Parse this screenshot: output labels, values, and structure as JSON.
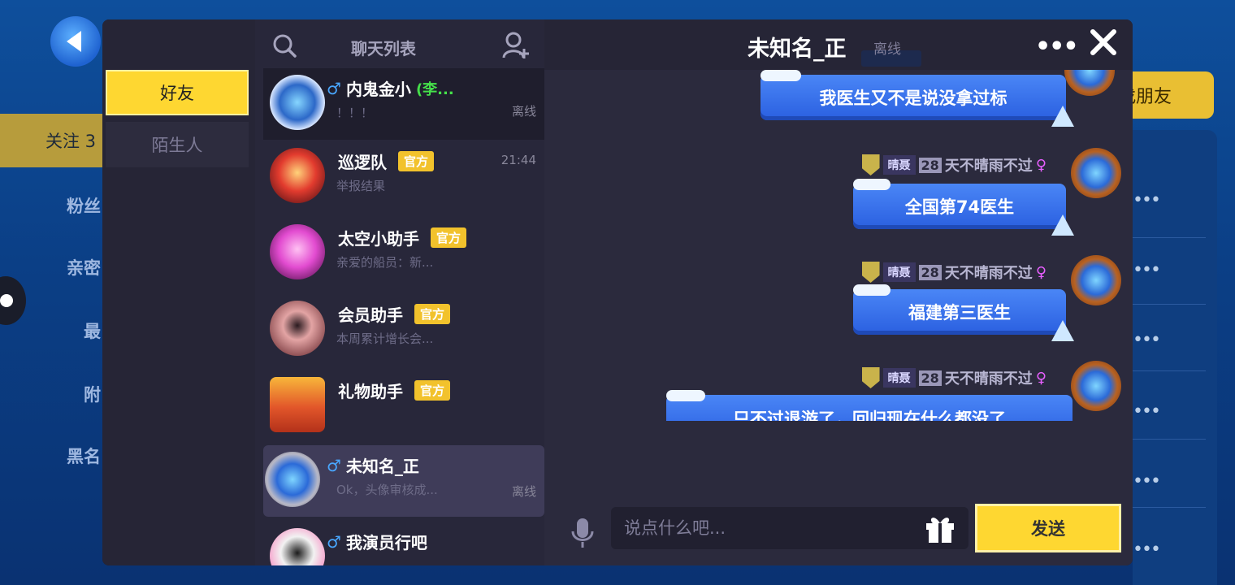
{
  "background": {
    "follow_label": "关注 3",
    "side_items": [
      "粉丝",
      "亲密",
      "最",
      "附",
      "黑名"
    ],
    "add_friend_label": "找朋友"
  },
  "tabs": {
    "friends": "好友",
    "strangers": "陌生人"
  },
  "chat_list": {
    "title": "聊天列表",
    "items": [
      {
        "name": "内鬼金小",
        "gender": "♂",
        "tag": "(李...",
        "preview": "！！！",
        "meta": "离线"
      },
      {
        "name": "巡逻队",
        "badge": "官方",
        "preview": "举报结果",
        "meta": "21:44"
      },
      {
        "name": "太空小助手",
        "badge": "官方",
        "preview": "亲爱的船员：新..."
      },
      {
        "name": "会员助手",
        "badge": "官方",
        "preview": "本周累计增长会..."
      },
      {
        "name": "礼物助手",
        "badge": "官方",
        "preview": ""
      },
      {
        "name": "未知名_正",
        "gender": "♂",
        "preview": "Ok，头像审核成...",
        "meta": "离线"
      },
      {
        "name": "我演员行吧",
        "gender": "♂",
        "preview": "",
        "meta": ""
      }
    ]
  },
  "chat": {
    "title": "未知名_正",
    "status": "离线",
    "more_label": "•••",
    "messages": [
      {
        "text": "我医生又不是说没拿过标"
      },
      {
        "rank": "晴聂",
        "level": "28",
        "sender": "天不晴雨不过",
        "gender": "♀",
        "text": "全国第74医生"
      },
      {
        "rank": "晴聂",
        "level": "28",
        "sender": "天不晴雨不过",
        "gender": "♀",
        "text": "福建第三医生"
      },
      {
        "rank": "晴聂",
        "level": "28",
        "sender": "天不晴雨不过",
        "gender": "♀",
        "text": "只不过退游了，回归现在什么都没了"
      }
    ],
    "input_placeholder": "说点什么吧...",
    "send_label": "发送"
  },
  "colors": {
    "accent": "#fed731",
    "bubble": "#3a72ee",
    "panel": "#232231",
    "official_badge": "#f2c22c"
  }
}
